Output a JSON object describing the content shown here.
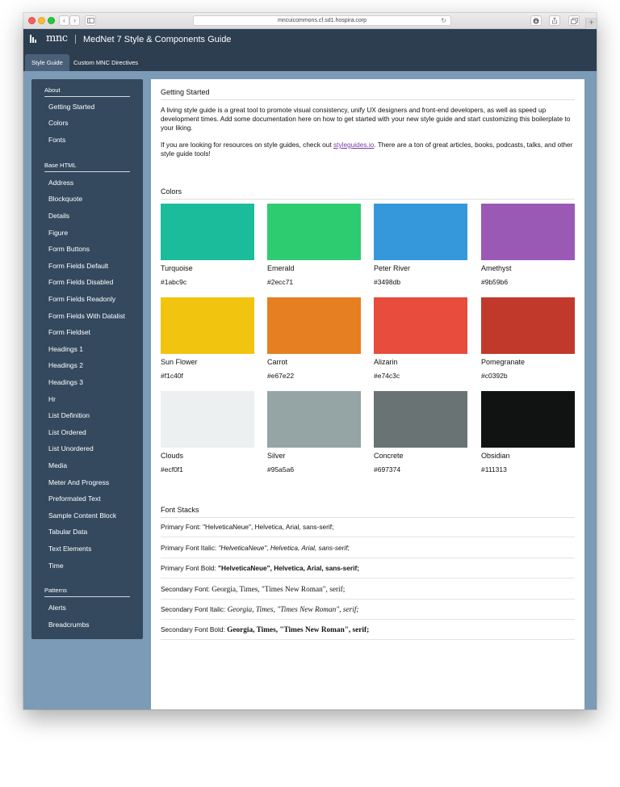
{
  "browser": {
    "url": "mncuicommons.cf.sd1.hospira.corp",
    "back_glyph": "‹",
    "forward_glyph": "›",
    "reload_glyph": "↻",
    "plus_glyph": "+"
  },
  "header": {
    "logo": "mnc",
    "title": "MedNet 7 Style & Components Guide"
  },
  "tabs": [
    {
      "label": "Style Guide",
      "active": true
    },
    {
      "label": "Custom MNC Directives",
      "active": false
    }
  ],
  "sidebar": {
    "sections": [
      {
        "heading": "About",
        "items": [
          "Getting Started",
          "Colors",
          "Fonts"
        ]
      },
      {
        "heading": "Base HTML",
        "items": [
          "Address",
          "Blockquote",
          "Details",
          "Figure",
          "Form Buttons",
          "Form Fields Default",
          "Form Fields Disabled",
          "Form Fields Readonly",
          "Form Fields With Datalist",
          "Form Fieldset",
          "Headings 1",
          "Headings 2",
          "Headings 3",
          "Hr",
          "List Definition",
          "List Ordered",
          "List Unordered",
          "Media",
          "Meter And Progress",
          "Preformated Text",
          "Sample Content Block",
          "Tabular Data",
          "Text Elements",
          "Time"
        ]
      },
      {
        "heading": "Patterns",
        "items": [
          "Alerts",
          "Breadcrumbs"
        ]
      }
    ]
  },
  "getting_started": {
    "title": "Getting Started",
    "paragraph1": "A living style guide is a great tool to promote visual consistency, unify UX designers and front-end developers, as well as speed up development times. Add some documentation here on how to get started with your new style guide and start customizing this boilerplate to your liking.",
    "paragraph2_prefix": "If you are looking for resources on style guides, check out ",
    "paragraph2_link": "styleguides.io",
    "paragraph2_suffix": ". There are a ton of great articles, books, podcasts, talks, and other style guide tools!"
  },
  "colors": {
    "title": "Colors",
    "swatches": [
      {
        "name": "Turquoise",
        "hex": "#1abc9c"
      },
      {
        "name": "Emerald",
        "hex": "#2ecc71"
      },
      {
        "name": "Peter River",
        "hex": "#3498db"
      },
      {
        "name": "Amethyst",
        "hex": "#9b59b6"
      },
      {
        "name": "Sun Flower",
        "hex": "#f1c40f"
      },
      {
        "name": "Carrot",
        "hex": "#e67e22"
      },
      {
        "name": "Alizarin",
        "hex": "#e74c3c"
      },
      {
        "name": "Pomegranate",
        "hex": "#c0392b"
      },
      {
        "name": "Clouds",
        "hex": "#ecf0f1"
      },
      {
        "name": "Silver",
        "hex": "#95a5a6"
      },
      {
        "name": "Concrete",
        "hex": "#697374"
      },
      {
        "name": "Obsidian",
        "hex": "#111313"
      }
    ]
  },
  "font_stacks": {
    "title": "Font Stacks",
    "rows": [
      {
        "label": "Primary Font: ",
        "stack": "\"HelveticaNeue\", Helvetica, Arial, sans-serif;"
      },
      {
        "label": "Primary Font Italic: ",
        "stack": "\"HelveticaNeue\", Helvetica, Arial, sans-serif;"
      },
      {
        "label": "Primary Font Bold: ",
        "stack": "\"HelveticaNeue\", Helvetica, Arial, sans-serif;"
      },
      {
        "label": "Secondary Font: ",
        "stack": "Georgia, Times, \"Times New Roman\", serif;"
      },
      {
        "label": "Secondary Font Italic: ",
        "stack": "Georgia, Times, \"Times New Roman\", serif;"
      },
      {
        "label": "Secondary Font Bold: ",
        "stack": "Georgia, Times, \"Times New Roman\", serif;"
      }
    ]
  }
}
